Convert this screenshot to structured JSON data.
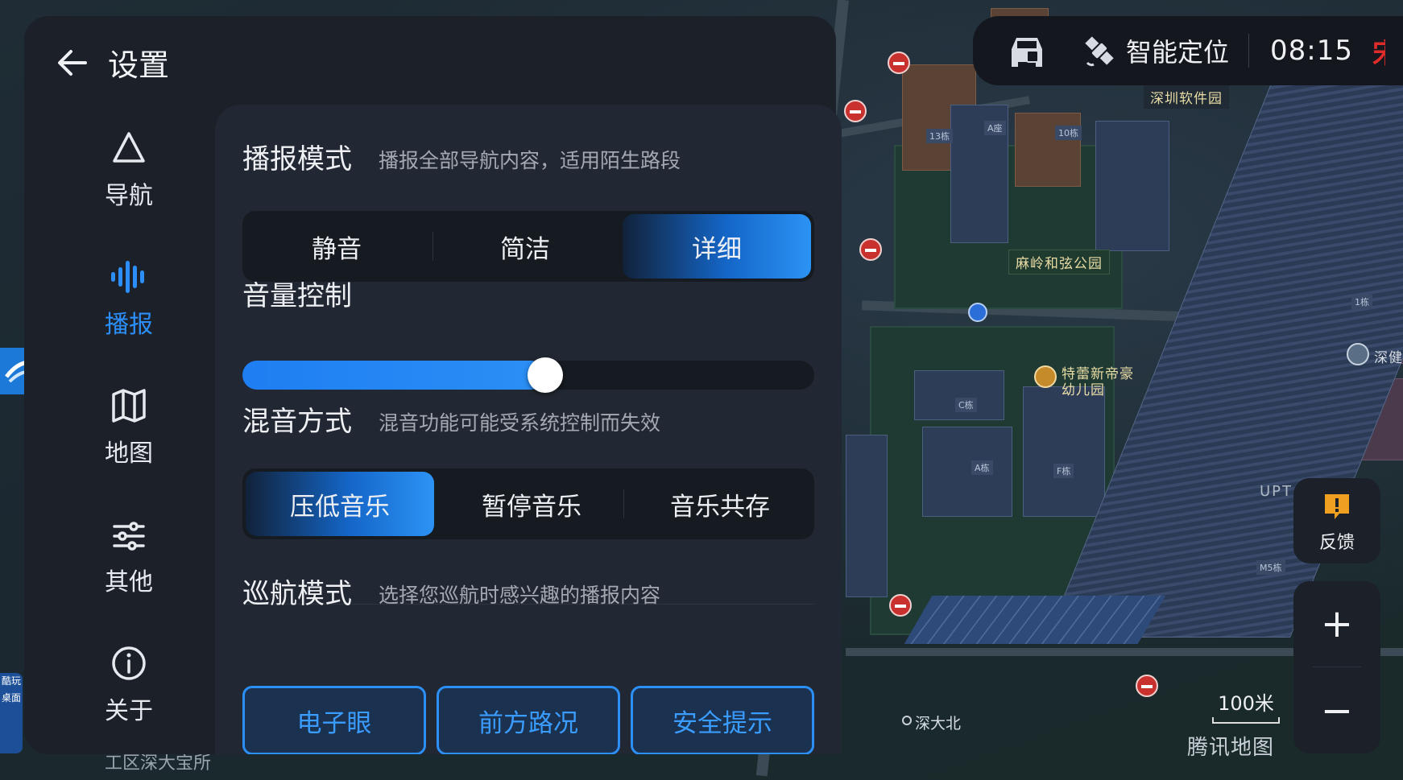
{
  "panel": {
    "title": "设置"
  },
  "sidebar": {
    "items": [
      {
        "label": "导航",
        "icon": "navigation-triangle-icon",
        "active": false
      },
      {
        "label": "播报",
        "icon": "sound-wave-icon",
        "active": true
      },
      {
        "label": "地图",
        "icon": "map-icon",
        "active": false
      },
      {
        "label": "其他",
        "icon": "sliders-icon",
        "active": false
      },
      {
        "label": "关于",
        "icon": "info-icon",
        "active": false
      }
    ]
  },
  "broadcast_mode": {
    "title": "播报模式",
    "subtitle": "播报全部导航内容，适用陌生路段",
    "options": [
      "静音",
      "简洁",
      "详细"
    ],
    "selected": "详细"
  },
  "volume": {
    "title": "音量控制",
    "level_fraction": 0.53
  },
  "mixing": {
    "title": "混音方式",
    "subtitle": "混音功能可能受系统控制而失效",
    "options": [
      "压低音乐",
      "暂停音乐",
      "音乐共存"
    ],
    "selected": "压低音乐"
  },
  "cruise": {
    "title": "巡航模式",
    "subtitle": "选择您巡航时感兴趣的播报内容",
    "chips": [
      "电子眼",
      "前方路况",
      "安全提示"
    ]
  },
  "status_bar": {
    "location_mode": "智能定位",
    "time": "08:15"
  },
  "map": {
    "labels": {
      "software_park": "深圳软件园",
      "park": "麻岭和弦公园",
      "kindergarten_line1": "特蕾新帝豪",
      "kindergarten_line2": "幼儿园",
      "subway": "深大北",
      "upt": "UPT",
      "bottom_left": "工区深大宝所",
      "shen_jian": "深健"
    },
    "building_tags": [
      "A座",
      "13栋",
      "10栋",
      "C栋",
      "A栋",
      "F栋",
      "M5栋",
      "1栋"
    ],
    "scale_label": "100米",
    "brand": "腾讯地图"
  },
  "controls": {
    "feedback_label": "反馈",
    "zoom_in": "+",
    "zoom_out": "−"
  },
  "side_tab": {
    "text": "酷玩桌面"
  },
  "colors": {
    "accent": "#2b8ff5",
    "panel_bg": "#1b2029",
    "content_bg": "#222833",
    "warning": "#f0a020"
  }
}
